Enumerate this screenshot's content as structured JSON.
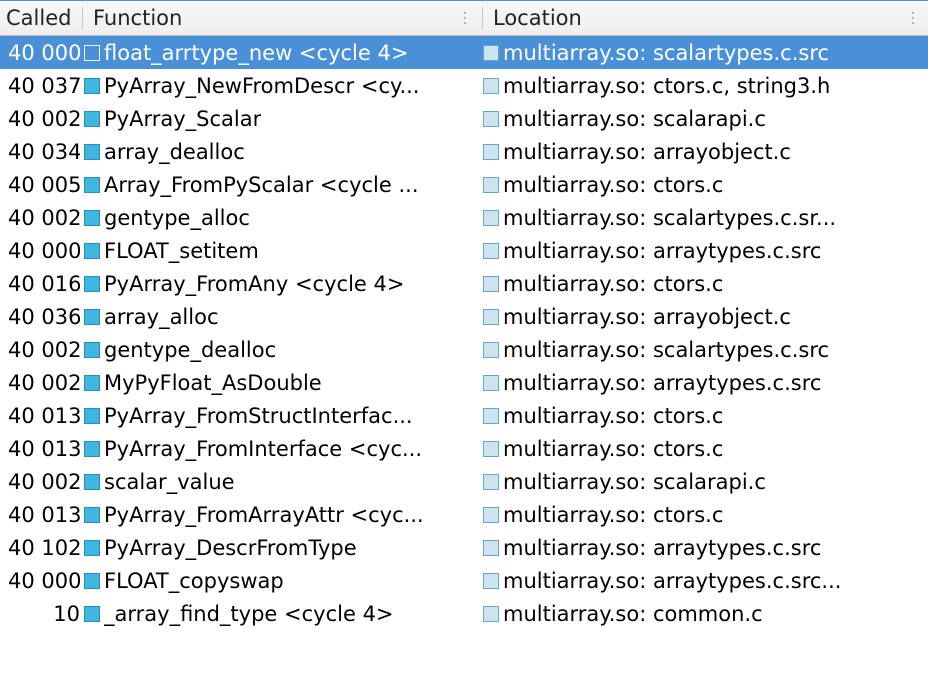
{
  "columns": {
    "called": "Called",
    "function": "Function",
    "location": "Location"
  },
  "rows": [
    {
      "called": "40 000",
      "func_icon": "empty",
      "function": "float_arrtype_new <cycle 4>",
      "location": "multiarray.so: scalartypes.c.src",
      "selected": true,
      "indent": false
    },
    {
      "called": "40 037",
      "func_icon": "filled",
      "function": "PyArray_NewFromDescr <cy...",
      "location": "multiarray.so: ctors.c, string3.h",
      "selected": false,
      "indent": false
    },
    {
      "called": "40 002",
      "func_icon": "filled",
      "function": "PyArray_Scalar",
      "location": "multiarray.so: scalarapi.c",
      "selected": false,
      "indent": false
    },
    {
      "called": "40 034",
      "func_icon": "filled",
      "function": "array_dealloc",
      "location": "multiarray.so: arrayobject.c",
      "selected": false,
      "indent": false
    },
    {
      "called": "40 005",
      "func_icon": "filled",
      "function": "Array_FromPyScalar <cycle ...",
      "location": "multiarray.so: ctors.c",
      "selected": false,
      "indent": false
    },
    {
      "called": "40 002",
      "func_icon": "filled",
      "function": "gentype_alloc",
      "location": "multiarray.so: scalartypes.c.sr...",
      "selected": false,
      "indent": false
    },
    {
      "called": "40 000",
      "func_icon": "filled",
      "function": "FLOAT_setitem",
      "location": "multiarray.so: arraytypes.c.src",
      "selected": false,
      "indent": false
    },
    {
      "called": "40 016",
      "func_icon": "filled",
      "function": "PyArray_FromAny <cycle 4>",
      "location": "multiarray.so: ctors.c",
      "selected": false,
      "indent": false
    },
    {
      "called": "40 036",
      "func_icon": "filled",
      "function": "array_alloc",
      "location": "multiarray.so: arrayobject.c",
      "selected": false,
      "indent": false
    },
    {
      "called": "40 002",
      "func_icon": "filled",
      "function": "gentype_dealloc",
      "location": "multiarray.so: scalartypes.c.src",
      "selected": false,
      "indent": false
    },
    {
      "called": "40 002",
      "func_icon": "filled",
      "function": "MyPyFloat_AsDouble",
      "location": "multiarray.so: arraytypes.c.src",
      "selected": false,
      "indent": false
    },
    {
      "called": "40 013",
      "func_icon": "filled",
      "function": "PyArray_FromStructInterfac...",
      "location": "multiarray.so: ctors.c",
      "selected": false,
      "indent": false
    },
    {
      "called": "40 013",
      "func_icon": "filled",
      "function": "PyArray_FromInterface <cyc...",
      "location": "multiarray.so: ctors.c",
      "selected": false,
      "indent": false
    },
    {
      "called": "40 002",
      "func_icon": "filled",
      "function": "scalar_value",
      "location": "multiarray.so: scalarapi.c",
      "selected": false,
      "indent": false
    },
    {
      "called": "40 013",
      "func_icon": "filled",
      "function": "PyArray_FromArrayAttr <cyc...",
      "location": "multiarray.so: ctors.c",
      "selected": false,
      "indent": false
    },
    {
      "called": "40 102",
      "func_icon": "filled",
      "function": "PyArray_DescrFromType",
      "location": "multiarray.so: arraytypes.c.src",
      "selected": false,
      "indent": false
    },
    {
      "called": "40 000",
      "func_icon": "filled",
      "function": "FLOAT_copyswap",
      "location": "multiarray.so: arraytypes.c.src...",
      "selected": false,
      "indent": false
    },
    {
      "called": "10",
      "func_icon": "filled",
      "function": "_array_find_type <cycle 4>",
      "location": "multiarray.so: common.c",
      "selected": false,
      "indent": true
    }
  ]
}
